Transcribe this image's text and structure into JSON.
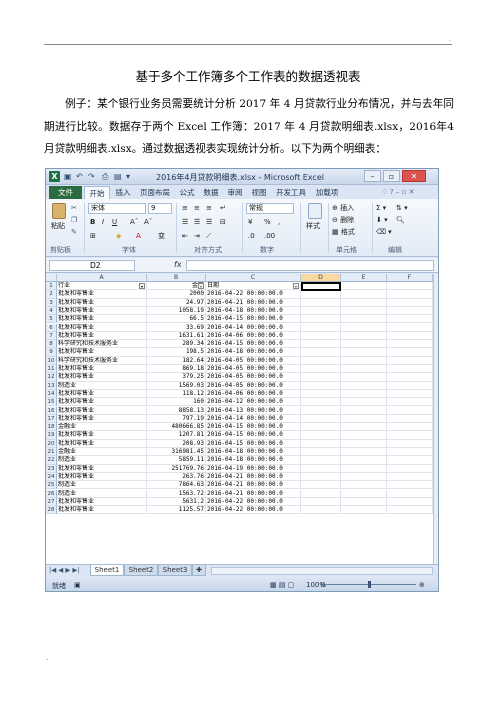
{
  "document": {
    "title": "基于多个工作簿多个工作表的数据透视表",
    "paragraph": "例子：某个银行业务员需要统计分析 2017 年 4 月贷款行业分布情况，并与去年同期进行比较。数据存于两个 Excel 工作簿：2017 年 4 月贷款明细表.xlsx，2016年4月贷款明细表.xlsx。通过数据透视表实现统计分析。以下为两个明细表：",
    "top_mark": ".",
    "bottom_mark": "."
  },
  "excel": {
    "window_title": "2016年4月贷款明细表.xlsx - Microsoft Excel",
    "tabs": [
      "文件",
      "开始",
      "插入",
      "页面布局",
      "公式",
      "数据",
      "审阅",
      "视图",
      "开发工具",
      "加载项"
    ],
    "ribbon": {
      "paste": "粘贴",
      "font_name": "宋体",
      "font_size": "9",
      "number_format": "常规",
      "insert": "插入",
      "delete": "删除",
      "format": "格式",
      "styles": "样式",
      "groups": [
        "剪贴板",
        "字体",
        "对齐方式",
        "数字",
        "单元格",
        "编辑"
      ]
    },
    "name_box": "D2",
    "fx": "fx",
    "columns": [
      "A",
      "B",
      "C",
      "D",
      "E",
      "F"
    ],
    "headers": {
      "a": "行业",
      "b": "金额",
      "c": "日期"
    },
    "rows": [
      {
        "n": "2",
        "a": "批发和零售业",
        "b": "2000",
        "c": "2016-04-22 00:00:00.0"
      },
      {
        "n": "3",
        "a": "批发和零售业",
        "b": "24.97",
        "c": "2016-04-21 00:00:00.0"
      },
      {
        "n": "4",
        "a": "批发和零售业",
        "b": "1058.19",
        "c": "2016-04-18 00:00:00.0"
      },
      {
        "n": "5",
        "a": "批发和零售业",
        "b": "66.5",
        "c": "2016-04-15 00:00:00.0"
      },
      {
        "n": "6",
        "a": "批发和零售业",
        "b": "33.69",
        "c": "2016-04-14 00:00:00.0"
      },
      {
        "n": "7",
        "a": "批发和零售业",
        "b": "1631.61",
        "c": "2016-04-06 00:00:00.0"
      },
      {
        "n": "8",
        "a": "科学研究和技术服务业",
        "b": "289.34",
        "c": "2016-04-15 00:00:00.0"
      },
      {
        "n": "9",
        "a": "批发和零售业",
        "b": "198.5",
        "c": "2016-04-18 00:00:00.0"
      },
      {
        "n": "10",
        "a": "科学研究和技术服务业",
        "b": "182.64",
        "c": "2016-04-05 00:00:00.0"
      },
      {
        "n": "11",
        "a": "批发和零售业",
        "b": "869.18",
        "c": "2016-04-05 00:00:00.0"
      },
      {
        "n": "12",
        "a": "批发和零售业",
        "b": "379.25",
        "c": "2016-04-05 00:00:00.0"
      },
      {
        "n": "13",
        "a": "制造业",
        "b": "1569.03",
        "c": "2016-04-05 00:00:00.0"
      },
      {
        "n": "14",
        "a": "批发和零售业",
        "b": "118.12",
        "c": "2016-04-06 00:00:00.0"
      },
      {
        "n": "15",
        "a": "批发和零售业",
        "b": "160",
        "c": "2016-04-12 00:00:00.0"
      },
      {
        "n": "16",
        "a": "批发和零售业",
        "b": "8858.13",
        "c": "2016-04-13 00:00:00.0"
      },
      {
        "n": "17",
        "a": "批发和零售业",
        "b": "797.19",
        "c": "2016-04-14 00:00:00.0"
      },
      {
        "n": "18",
        "a": "金融业",
        "b": "480666.85",
        "c": "2016-04-15 00:00:00.0"
      },
      {
        "n": "19",
        "a": "批发和零售业",
        "b": "1207.81",
        "c": "2016-04-15 00:00:00.0"
      },
      {
        "n": "20",
        "a": "批发和零售业",
        "b": "208.93",
        "c": "2016-04-15 00:00:00.0"
      },
      {
        "n": "21",
        "a": "金融业",
        "b": "316981.45",
        "c": "2016-04-18 00:00:00.0"
      },
      {
        "n": "22",
        "a": "制造业",
        "b": "5859.11",
        "c": "2016-04-18 00:00:00.0"
      },
      {
        "n": "23",
        "a": "批发和零售业",
        "b": "251769.76",
        "c": "2016-04-19 00:00:00.0"
      },
      {
        "n": "24",
        "a": "批发和零售业",
        "b": "263.76",
        "c": "2016-04-21 00:00:00.0"
      },
      {
        "n": "25",
        "a": "制造业",
        "b": "7864.63",
        "c": "2016-04-21 00:00:00.0"
      },
      {
        "n": "26",
        "a": "制造业",
        "b": "1563.72",
        "c": "2016-04-21 00:00:00.0"
      },
      {
        "n": "27",
        "a": "批发和零售业",
        "b": "5631.2",
        "c": "2016-04-22 00:00:00.0"
      },
      {
        "n": "28",
        "a": "批发和零售业",
        "b": "1125.57",
        "c": "2016-04-22 00:00:00.0"
      }
    ],
    "sheets": [
      "Sheet1",
      "Sheet2",
      "Sheet3"
    ],
    "status_ready": "就绪",
    "zoom": "100%"
  }
}
